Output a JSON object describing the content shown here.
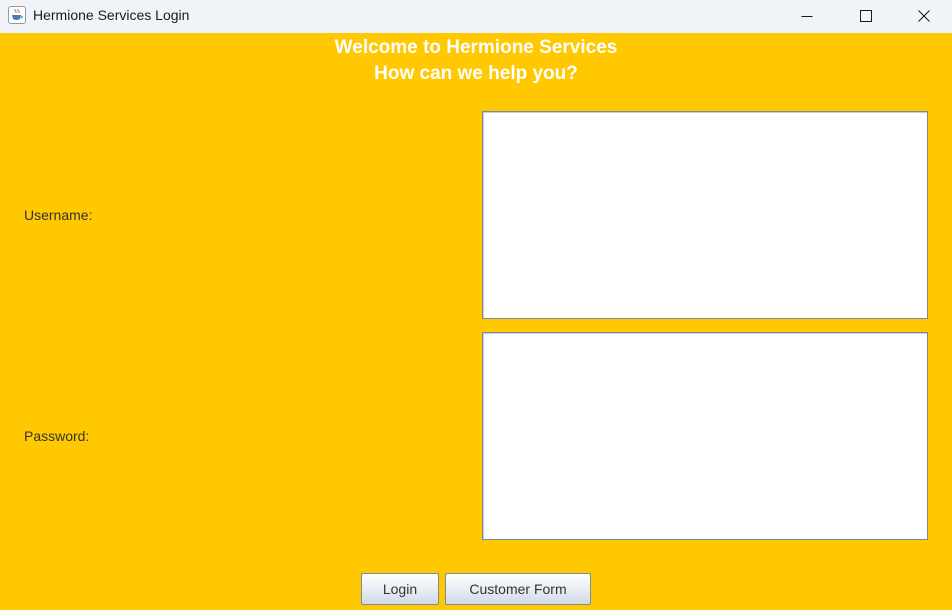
{
  "window": {
    "title": "Hermione Services Login",
    "icon": "java-cup-icon",
    "controls": [
      "minimize-icon",
      "maximize-icon",
      "close-icon"
    ]
  },
  "heading": {
    "line1": "Welcome to Hermione Services",
    "line2": "How can we help you?"
  },
  "form": {
    "username_label": "Username:",
    "username_value": "",
    "password_label": "Password:",
    "password_value": ""
  },
  "buttons": {
    "login": "Login",
    "customer_form": "Customer Form"
  },
  "colors": {
    "background": "#ffc800",
    "heading_text": "#ffffff",
    "titlebar": "#f0f4f9"
  }
}
